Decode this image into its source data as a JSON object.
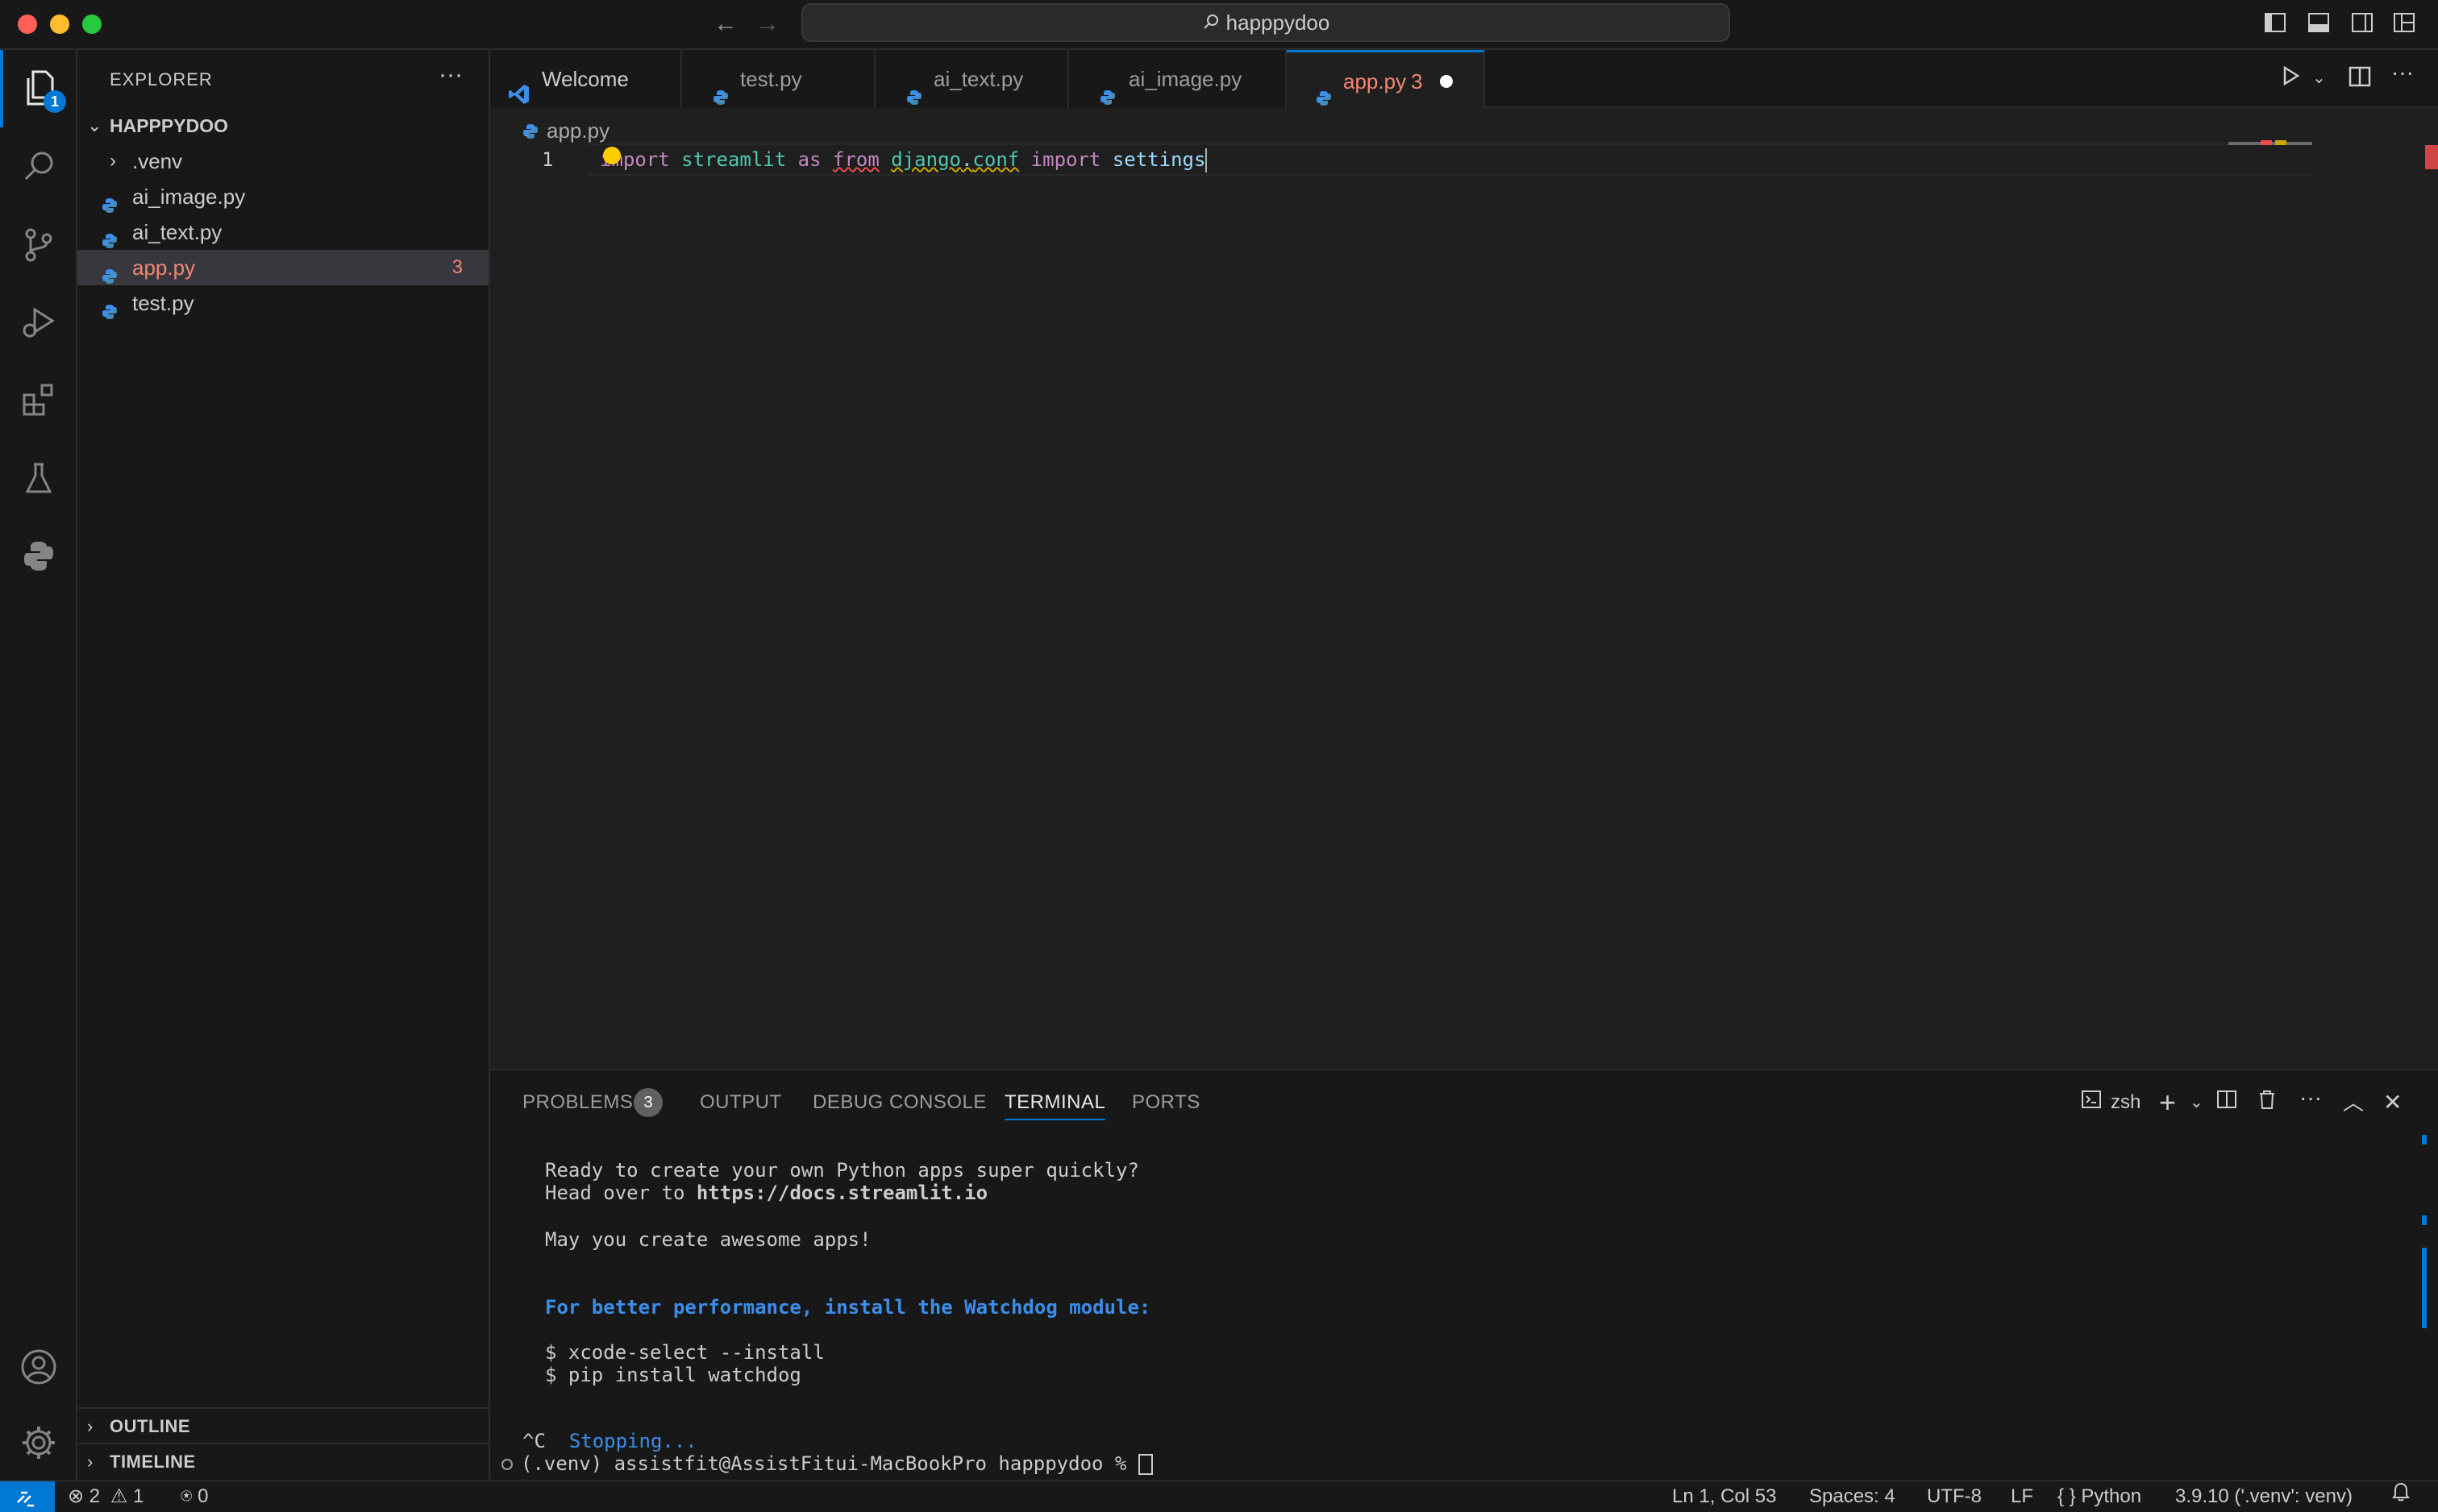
{
  "window": {
    "search_text": "happpydoo"
  },
  "activity_bar": {
    "explorer_badge": "1"
  },
  "sidebar": {
    "title": "EXPLORER",
    "more": "···",
    "root_folder": "HAPPPYDOO",
    "items": [
      {
        "label": ".venv",
        "type": "folder"
      },
      {
        "label": "ai_image.py",
        "type": "file"
      },
      {
        "label": "ai_text.py",
        "type": "file"
      },
      {
        "label": "app.py",
        "type": "file",
        "problems": "3",
        "selected": true
      },
      {
        "label": "test.py",
        "type": "file"
      }
    ],
    "sections": [
      {
        "label": "OUTLINE"
      },
      {
        "label": "TIMELINE"
      }
    ]
  },
  "tabs": [
    {
      "label": "Welcome"
    },
    {
      "label": "test.py"
    },
    {
      "label": "ai_text.py"
    },
    {
      "label": "ai_image.py"
    },
    {
      "label": "app.py",
      "problems": "3",
      "active": true,
      "dirty": true
    }
  ],
  "editor": {
    "breadcrumb": "app.py",
    "line_number": "1",
    "tokens": {
      "t1": "import",
      "t2": "streamlit",
      "t3": "as",
      "t4": "from",
      "t5": "django",
      "t6": ".",
      "t7": "conf",
      "t8": "import",
      "t9": "settings"
    }
  },
  "panel": {
    "tabs": {
      "problems": "PROBLEMS",
      "problems_count": "3",
      "output": "OUTPUT",
      "debug_console": "DEBUG CONSOLE",
      "terminal": "TERMINAL",
      "ports": "PORTS"
    },
    "shell": "zsh",
    "terminal": {
      "l1": "Ready to create your own Python apps super quickly?",
      "l2_prefix": "Head over to ",
      "l2_link": "https://docs.streamlit.io",
      "l3": "May you create awesome apps!",
      "l4": "For better performance, install the Watchdog module:",
      "l5": "$ xcode-select --install",
      "l6": "$ pip install watchdog",
      "l7_prefix": "^C",
      "l7_msg": "Stopping...",
      "prompt": "(.venv) assistfit@AssistFitui-MacBookPro happpydoo % "
    }
  },
  "status_bar": {
    "errors": "2",
    "warnings": "1",
    "ports": "0",
    "position": "Ln 1, Col 53",
    "spaces": "Spaces: 4",
    "encoding": "UTF-8",
    "eol": "LF",
    "language": "Python",
    "interpreter": "3.9.10 ('.venv': venv)"
  },
  "colors": {
    "accent": "#0078d4",
    "error": "#f14c4c",
    "problem_text": "#f48771",
    "background": "#1f1f1f",
    "chrome": "#181818"
  }
}
